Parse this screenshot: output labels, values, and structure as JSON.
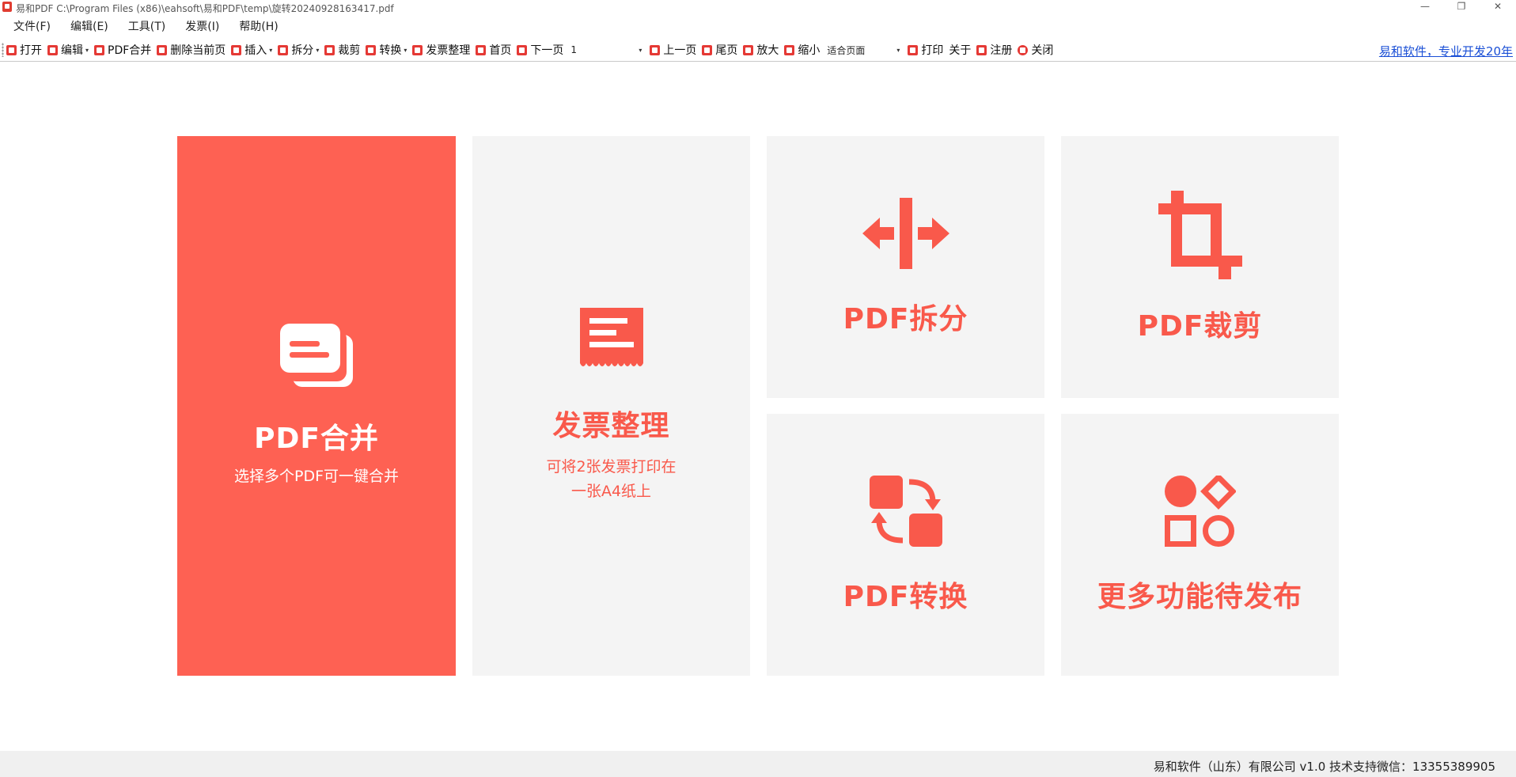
{
  "window": {
    "title": "易和PDF  C:\\Program Files (x86)\\eahsoft\\易和PDF\\temp\\旋转20240928163417.pdf",
    "minimize_glyph": "—",
    "restore_glyph": "❐",
    "close_glyph": "✕"
  },
  "menu": [
    "文件(F)",
    "编辑(E)",
    "工具(T)",
    "发票(I)",
    "帮助(H)"
  ],
  "toolbar": {
    "open": "打开",
    "edit": "编辑",
    "merge": "PDF合并",
    "delete_page": "删除当前页",
    "insert": "插入",
    "split": "拆分",
    "crop": "裁剪",
    "convert": "转换",
    "invoice": "发票整理",
    "first_page": "首页",
    "next_page": "下一页",
    "page_value": "1",
    "prev_page": "上一页",
    "last_page": "尾页",
    "zoom_in": "放大",
    "zoom_out": "缩小",
    "fit_value": "适合页面",
    "print": "打印",
    "about": "关于",
    "register": "注册",
    "close": "关闭",
    "promo_link": "易和软件，专业开发20年",
    "dropdown_arrow": "▾"
  },
  "tiles": {
    "merge": {
      "title": "PDF合并",
      "subtitle": "选择多个PDF可一键合并",
      "icon": "document-stack-icon"
    },
    "invoice": {
      "title": "发票整理",
      "subtitle_line1": "可将2张发票打印在",
      "subtitle_line2": "一张A4纸上",
      "icon": "receipt-icon"
    },
    "split": {
      "title": "PDF拆分",
      "icon": "split-arrows-icon"
    },
    "crop": {
      "title": "PDF裁剪",
      "icon": "crop-icon"
    },
    "convert": {
      "title": "PDF转换",
      "icon": "convert-swap-icon"
    },
    "more": {
      "title": "更多功能待发布",
      "icon": "shapes-icon"
    }
  },
  "status": {
    "text": "易和软件（山东）有限公司  v1.0 技术支持微信：13355389905"
  },
  "colors": {
    "accent": "#fe6153",
    "accent_text": "#f9594b",
    "tile_bg": "#f4f4f4",
    "link": "#1a4fd6"
  }
}
